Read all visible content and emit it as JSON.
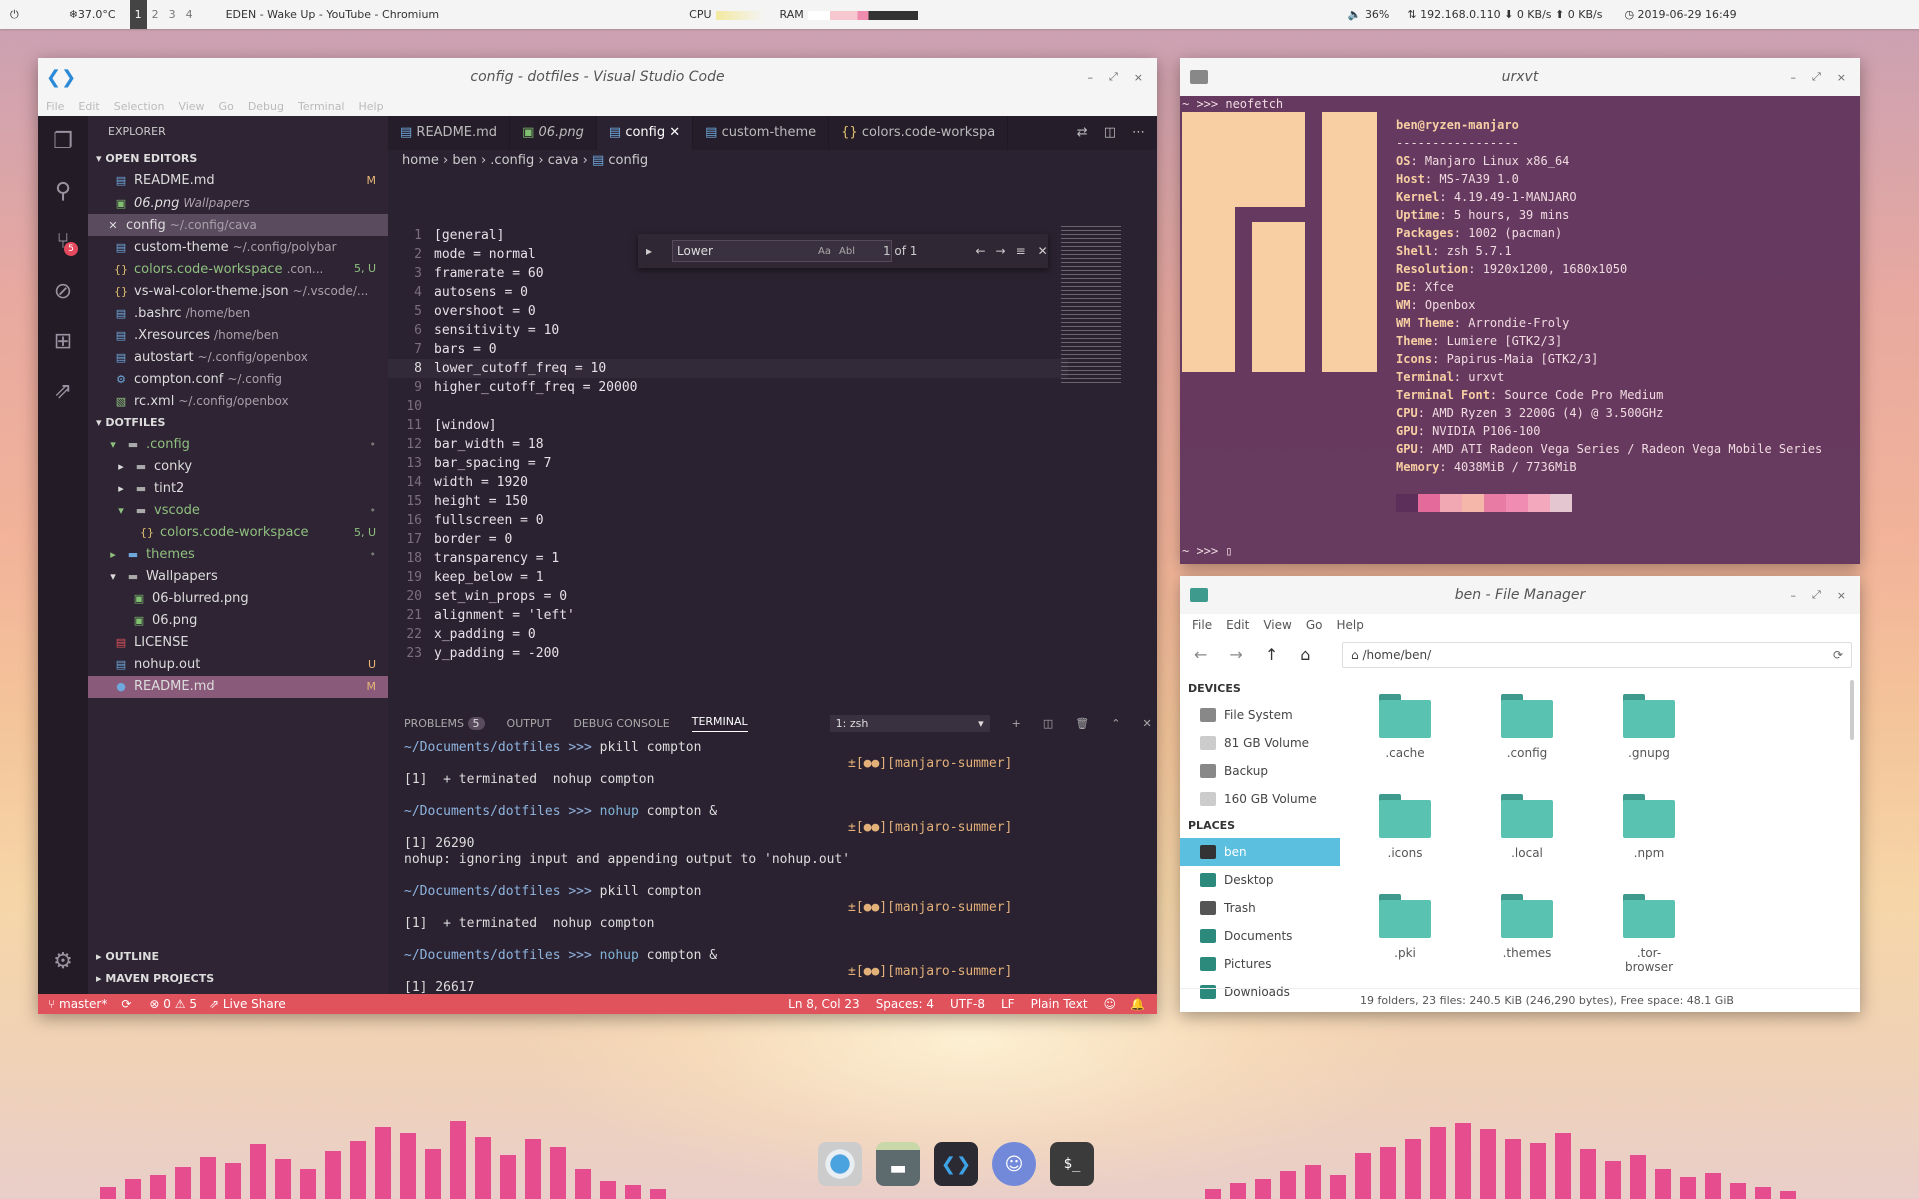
{
  "panel": {
    "temp": "37.0°C",
    "workspaces": [
      "1",
      "2",
      "3",
      "4"
    ],
    "active_workspace": "1",
    "window_title": "EDEN - Wake Up - YouTube - Chromium",
    "cpu_label": "CPU",
    "ram_label": "RAM",
    "volume": "36%",
    "ip": "192.168.0.110",
    "down": "0 KB/s",
    "up": "0 KB/s",
    "datetime": "2019-06-29  16:49"
  },
  "vscode": {
    "title": "config - dotfiles - Visual Studio Code",
    "menu": [
      "File",
      "Edit",
      "Selection",
      "View",
      "Go",
      "Debug",
      "Terminal",
      "Help"
    ],
    "explorer": "EXPLORER",
    "open_editors_title": "OPEN EDITORS",
    "open_editors": [
      {
        "name": "README.md",
        "sub": "",
        "status": "M"
      },
      {
        "name": "06.png",
        "sub": "Wallpapers",
        "status": ""
      },
      {
        "name": "config",
        "sub": "~/.config/cava",
        "status": ""
      },
      {
        "name": "custom-theme",
        "sub": "~/.config/polybar",
        "status": ""
      },
      {
        "name": "colors.code-workspace",
        "sub": ".con...",
        "status": "5, U"
      },
      {
        "name": "vs-wal-color-theme.json",
        "sub": "~/.vscode/...",
        "status": ""
      },
      {
        "name": ".bashrc",
        "sub": "/home/ben",
        "status": ""
      },
      {
        "name": ".Xresources",
        "sub": "/home/ben",
        "status": ""
      },
      {
        "name": "autostart",
        "sub": "~/.config/openbox",
        "status": ""
      },
      {
        "name": "compton.conf",
        "sub": "~/.config",
        "status": ""
      },
      {
        "name": "rc.xml",
        "sub": "~/.config/openbox",
        "status": ""
      }
    ],
    "dotfiles_title": "DOTFILES",
    "tree": [
      {
        "name": ".config",
        "status": "•"
      },
      {
        "name": "conky",
        "status": ""
      },
      {
        "name": "tint2",
        "status": ""
      },
      {
        "name": "vscode",
        "status": "•"
      },
      {
        "name": "colors.code-workspace",
        "status": "5, U"
      },
      {
        "name": "themes",
        "status": "•"
      },
      {
        "name": "Wallpapers",
        "status": ""
      },
      {
        "name": "06-blurred.png",
        "status": ""
      },
      {
        "name": "06.png",
        "status": ""
      },
      {
        "name": "LICENSE",
        "status": ""
      },
      {
        "name": "nohup.out",
        "status": "U"
      },
      {
        "name": "README.md",
        "status": "M"
      }
    ],
    "outline": "OUTLINE",
    "maven": "MAVEN PROJECTS",
    "tabs": [
      "README.md",
      "06.png",
      "config",
      "custom-theme",
      "colors.code-workspa"
    ],
    "breadcrumb": [
      "home",
      "ben",
      ".config",
      "cava",
      "config"
    ],
    "find": {
      "value": "Lower",
      "result": "1 of 1",
      "aa": "Aa",
      "ab": "Abl",
      ".*": ".*"
    },
    "code": [
      "[general]",
      "mode = normal",
      "framerate = 60",
      "autosens = 0",
      "overshoot = 0",
      "sensitivity = 10",
      "bars = 0",
      "lower_cutoff_freq = 10",
      "higher_cutoff_freq = 20000",
      "",
      "[window]",
      "bar_width = 18",
      "bar_spacing = 7",
      "width = 1920",
      "height = 150",
      "fullscreen = 0",
      "border = 0",
      "transparency = 1",
      "keep_below = 1",
      "set_win_props = 0",
      "alignment = 'left'",
      "x_padding = 0",
      "y_padding = -200"
    ],
    "panel_tabs": {
      "problems": "PROBLEMS",
      "problems_count": "5",
      "output": "OUTPUT",
      "debug": "DEBUG CONSOLE",
      "terminal": "TERMINAL",
      "shell": "1: zsh"
    },
    "terminal": {
      "prompt": "~/Documents/dotfiles >>>",
      "branch": "±[●●][manjaro-summer]",
      "cmd1": "pkill compton",
      "out1": "[1]  + terminated  nohup compton",
      "cmd2a": "nohup",
      "cmd2b": " compton &",
      "out2a": "[1] 26290",
      "out2b": "nohup: ignoring input and appending output to 'nohup.out'",
      "out3a": "[1] 26617"
    },
    "status": {
      "branch": "master*",
      "errors": "0",
      "warnings": "5",
      "liveshare": "Live Share",
      "pos": "Ln 8, Col 23",
      "spaces": "Spaces: 4",
      "enc": "UTF-8",
      "eol": "LF",
      "lang": "Plain Text"
    }
  },
  "urxvt": {
    "title": "urxvt",
    "prompt": "~ >>> ",
    "cmd": "neofetch",
    "userhost": "ben@ryzen-manjaro",
    "sep": "-----------------",
    "info": [
      [
        "OS",
        "Manjaro Linux x86_64"
      ],
      [
        "Host",
        "MS-7A39 1.0"
      ],
      [
        "Kernel",
        "4.19.49-1-MANJARO"
      ],
      [
        "Uptime",
        "5 hours, 39 mins"
      ],
      [
        "Packages",
        "1002 (pacman)"
      ],
      [
        "Shell",
        "zsh 5.7.1"
      ],
      [
        "Resolution",
        "1920x1200, 1680x1050"
      ],
      [
        "DE",
        "Xfce"
      ],
      [
        "WM",
        "Openbox"
      ],
      [
        "WM Theme",
        "Arrondie-Froly"
      ],
      [
        "Theme",
        "Lumiere [GTK2/3]"
      ],
      [
        "Icons",
        "Papirus-Maia [GTK2/3]"
      ],
      [
        "Terminal",
        "urxvt"
      ],
      [
        "Terminal Font",
        "Source Code Pro Medium"
      ],
      [
        "CPU",
        "AMD Ryzen 3 2200G (4) @ 3.500GHz"
      ],
      [
        "GPU",
        "NVIDIA P106-100"
      ],
      [
        "GPU",
        "AMD ATI Radeon Vega Series / Radeon Vega Mobile Series"
      ],
      [
        "Memory",
        "4038MiB / 7736MiB"
      ]
    ]
  },
  "fm": {
    "title": "ben - File Manager",
    "menu": [
      "File",
      "Edit",
      "View",
      "Go",
      "Help"
    ],
    "path": "/home/ben/",
    "devices_title": "DEVICES",
    "devices": [
      "File System",
      "81 GB Volume",
      "Backup",
      "160 GB Volume"
    ],
    "places_title": "PLACES",
    "places": [
      "ben",
      "Desktop",
      "Trash",
      "Documents",
      "Pictures",
      "Downloads"
    ],
    "folders": [
      ".cache",
      ".config",
      ".gnupg",
      ".icons",
      ".local",
      ".npm",
      ".pki",
      ".themes",
      ".tor-browser"
    ],
    "status": "19 folders, 23 files: 240.5 KiB (246,290 bytes), Free space: 48.1 GiB"
  },
  "visualizer_bars": [
    0.12,
    0.2,
    0.24,
    0.32,
    0.42,
    0.36,
    0.55,
    0.4,
    0.3,
    0.48,
    0.58,
    0.72,
    0.66,
    0.5,
    0.78,
    0.62,
    0.44,
    0.6,
    0.52,
    0.3,
    0.18,
    0.14,
    0.1
  ],
  "visualizer_bars_right": [
    0.1,
    0.16,
    0.2,
    0.28,
    0.34,
    0.24,
    0.46,
    0.52,
    0.6,
    0.72,
    0.76,
    0.7,
    0.6,
    0.56,
    0.66,
    0.5,
    0.38,
    0.44,
    0.3,
    0.22,
    0.26,
    0.16,
    0.12,
    0.08
  ]
}
